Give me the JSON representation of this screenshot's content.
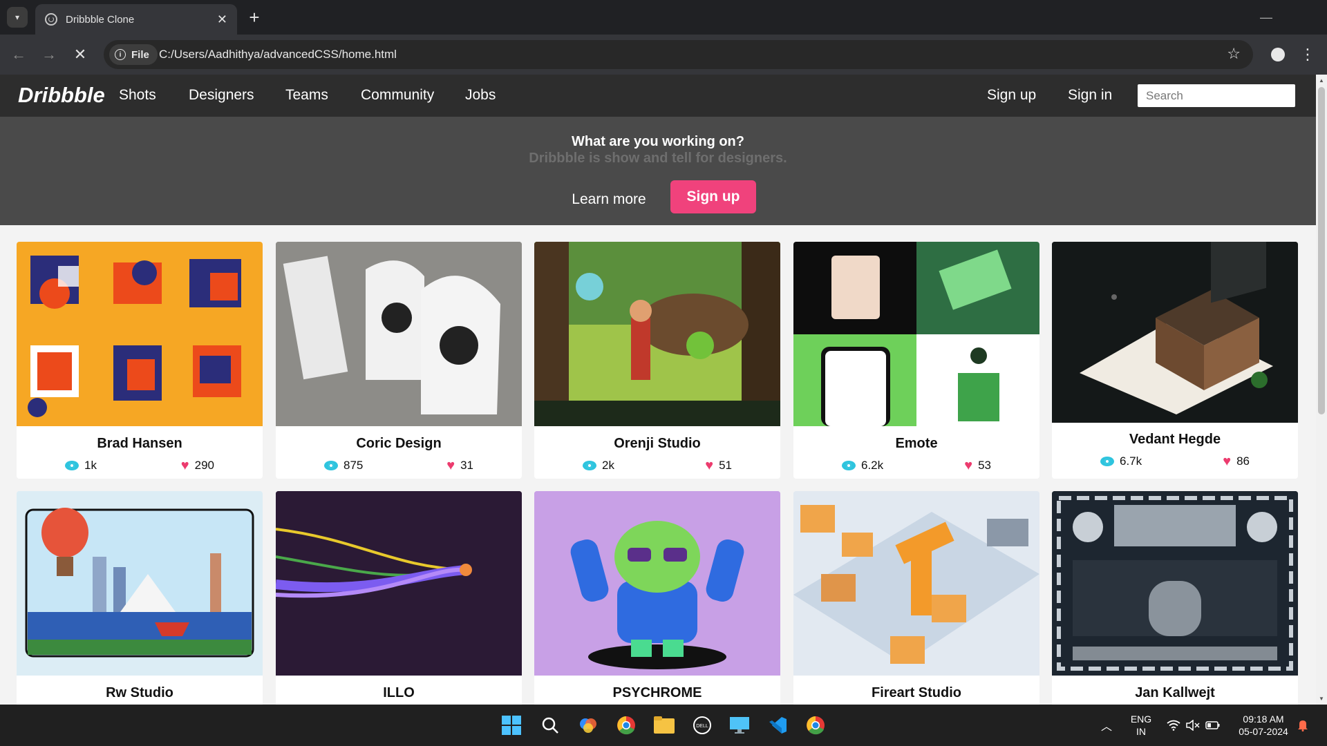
{
  "browser": {
    "tab_title": "Dribbble Clone",
    "url_chip": "File",
    "url": "C:/Users/Aadhithya/advancedCSS/home.html"
  },
  "site": {
    "logo": "Dribbble",
    "nav": [
      "Shots",
      "Designers",
      "Teams",
      "Community",
      "Jobs"
    ],
    "sign_up": "Sign up",
    "sign_in": "Sign in",
    "search_placeholder": "Search"
  },
  "hero": {
    "title": "What are you working on?",
    "subtitle": "Dribbble is show and tell for designers.",
    "learn_more": "Learn more",
    "sign_up": "Sign up"
  },
  "shots": [
    {
      "name": "Brad Hansen",
      "views": "1k",
      "likes": "290"
    },
    {
      "name": "Coric Design",
      "views": "875",
      "likes": "31"
    },
    {
      "name": "Orenji Studio",
      "views": "2k",
      "likes": "51"
    },
    {
      "name": "Emote",
      "views": "6.2k",
      "likes": "53"
    },
    {
      "name": "Vedant Hegde",
      "views": "6.7k",
      "likes": "86"
    },
    {
      "name": "Rw Studio"
    },
    {
      "name": "ILLO"
    },
    {
      "name": "PSYCHROME"
    },
    {
      "name": "Fireart Studio"
    },
    {
      "name": "Jan Kallwejt"
    }
  ],
  "taskbar": {
    "lang_top": "ENG",
    "lang_bottom": "IN",
    "time": "09:18 AM",
    "date": "05-07-2024"
  },
  "colors": {
    "accent_pink": "#f0427c",
    "view_icon": "#2ec4de",
    "like_icon": "#ec3b6e"
  }
}
